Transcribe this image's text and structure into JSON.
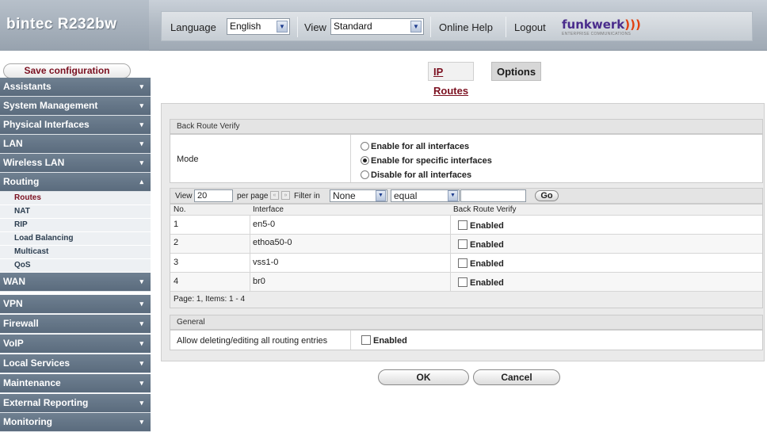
{
  "header": {
    "device_name": "bintec R232bw",
    "language_label": "Language",
    "language_value": "English",
    "view_label": "View",
    "view_value": "Standard",
    "online_help": "Online Help",
    "logout": "Logout",
    "logo_text": "funkwerk",
    "logo_sub": "ENTERPRISE COMMUNICATIONS"
  },
  "sidebar": {
    "save_label": "Save configuration",
    "items": [
      {
        "label": "Assistants",
        "chevron": "▾"
      },
      {
        "label": "System Management",
        "chevron": "▾"
      },
      {
        "label": "Physical Interfaces",
        "chevron": "▾"
      },
      {
        "label": "LAN",
        "chevron": "▾"
      },
      {
        "label": "Wireless LAN",
        "chevron": "▾"
      },
      {
        "label": "Routing",
        "chevron": "▴"
      },
      {
        "label": "WAN",
        "chevron": "▾"
      },
      {
        "label": "VPN",
        "chevron": "▾"
      },
      {
        "label": "Firewall",
        "chevron": "▾"
      },
      {
        "label": "VoIP",
        "chevron": "▾"
      },
      {
        "label": "Local Services",
        "chevron": "▾"
      },
      {
        "label": "Maintenance",
        "chevron": "▾"
      },
      {
        "label": "External Reporting",
        "chevron": "▾"
      },
      {
        "label": "Monitoring",
        "chevron": "▾"
      }
    ],
    "routing_subitems": [
      "Routes",
      "NAT",
      "RIP",
      "Load Balancing",
      "Multicast",
      "QoS"
    ]
  },
  "tabs": {
    "ip_routes": "IP Routes",
    "options": "Options"
  },
  "back_route": {
    "section_title": "Back Route Verify",
    "mode_label": "Mode",
    "options": [
      {
        "label": "Enable for all interfaces",
        "selected": false
      },
      {
        "label": "Enable for specific interfaces",
        "selected": true
      },
      {
        "label": "Disable for all interfaces",
        "selected": false
      }
    ]
  },
  "filter": {
    "view_label": "View",
    "view_value": "20",
    "per_page_label": "per page",
    "filter_in_label": "Filter in",
    "filter_field": "None",
    "filter_op": "equal",
    "filter_value": "",
    "go_label": "Go"
  },
  "table": {
    "columns": [
      "No.",
      "Interface",
      "Back Route Verify"
    ],
    "rows": [
      {
        "no": "1",
        "interface": "en5-0",
        "check_label": "Enabled",
        "checked": false
      },
      {
        "no": "2",
        "interface": "ethoa50-0",
        "check_label": "Enabled",
        "checked": false
      },
      {
        "no": "3",
        "interface": "vss1-0",
        "check_label": "Enabled",
        "checked": false
      },
      {
        "no": "4",
        "interface": "br0",
        "check_label": "Enabled",
        "checked": false
      }
    ],
    "page_info": "Page: 1, Items: 1 - 4"
  },
  "general": {
    "section_title": "General",
    "allow_label": "Allow deleting/editing all routing entries",
    "allow_check_label": "Enabled",
    "allow_checked": false
  },
  "buttons": {
    "ok": "OK",
    "cancel": "Cancel"
  }
}
